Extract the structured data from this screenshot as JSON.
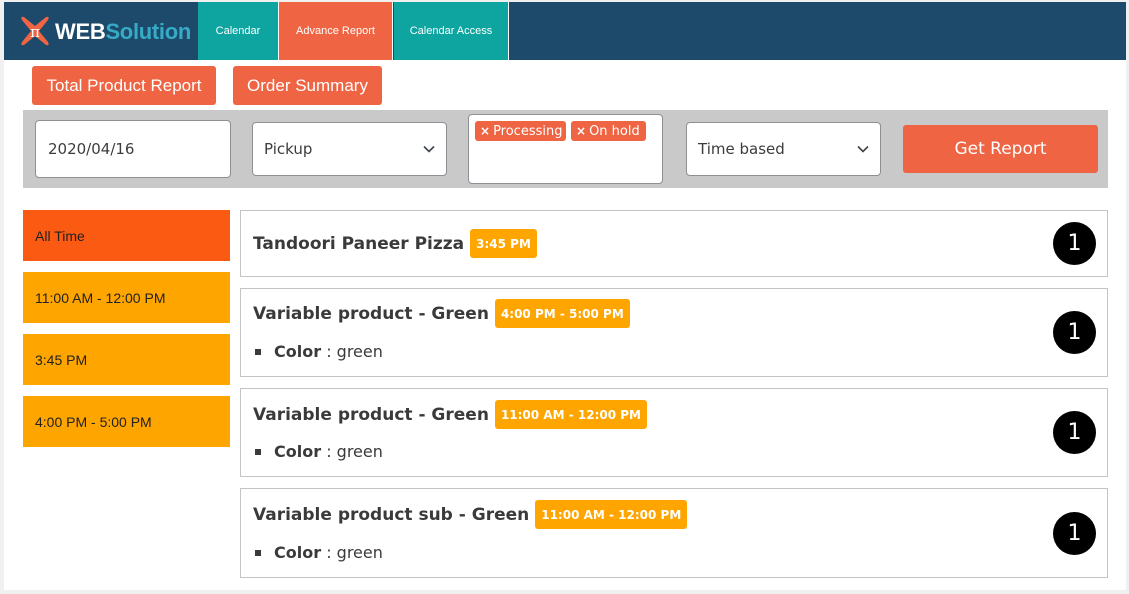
{
  "brand": {
    "name_part1": "WEB",
    "name_part2": "Solution",
    "logo_glyph": "π",
    "colors": {
      "navy": "#1d4a6b",
      "teal": "#0ea5a0",
      "orange": "#ef6443",
      "accent_blue": "#37aac6"
    }
  },
  "nav": {
    "tabs": [
      {
        "label": "Calendar",
        "active": false
      },
      {
        "label": "Advance Report",
        "active": true
      },
      {
        "label": "Calendar Access",
        "active": false
      }
    ]
  },
  "report_buttons": {
    "total": "Total Product Report",
    "order": "Order Summary"
  },
  "filters": {
    "date": "2020/04/16",
    "delivery_type": "Pickup",
    "statuses": [
      {
        "remove": "×",
        "label": "Processing"
      },
      {
        "remove": "×",
        "label": "On hold"
      }
    ],
    "report_type": "Time based",
    "submit": "Get Report"
  },
  "time_slots": [
    {
      "label": "All Time",
      "active": true
    },
    {
      "label": "11:00 AM - 12:00 PM",
      "active": false
    },
    {
      "label": "3:45 PM",
      "active": false
    },
    {
      "label": "4:00 PM - 5:00 PM",
      "active": false
    }
  ],
  "products": [
    {
      "name": "Tandoori Paneer Pizza",
      "time": "3:45 PM",
      "attributes": [],
      "quantity": "1"
    },
    {
      "name": "Variable product - Green",
      "time": "4:00 PM - 5:00 PM",
      "attributes": [
        {
          "name": "Color",
          "sep": " : ",
          "value": "green"
        }
      ],
      "quantity": "1"
    },
    {
      "name": "Variable product - Green",
      "time": "11:00 AM - 12:00 PM",
      "attributes": [
        {
          "name": "Color",
          "sep": " : ",
          "value": "green"
        }
      ],
      "quantity": "1"
    },
    {
      "name": "Variable product sub - Green",
      "time": "11:00 AM - 12:00 PM",
      "attributes": [
        {
          "name": "Color",
          "sep": " : ",
          "value": "green"
        }
      ],
      "quantity": "1"
    }
  ]
}
